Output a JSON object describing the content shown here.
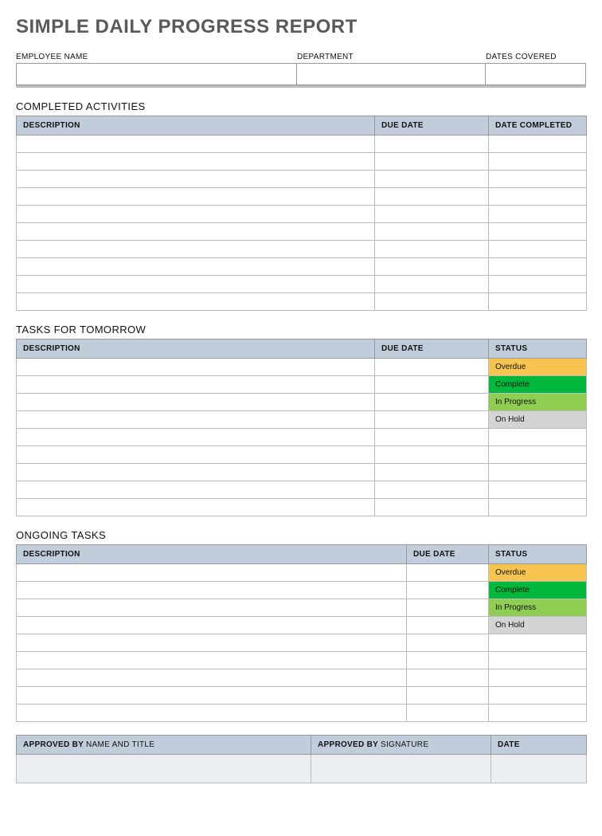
{
  "title": "SIMPLE DAILY PROGRESS REPORT",
  "header": {
    "employee_label": "EMPLOYEE NAME",
    "department_label": "DEPARTMENT",
    "dates_label": "DATES COVERED",
    "employee": "",
    "department": "",
    "dates": ""
  },
  "sections": {
    "completed": {
      "title": "COMPLETED ACTIVITIES",
      "cols": {
        "desc": "DESCRIPTION",
        "due": "DUE DATE",
        "done": "DATE COMPLETED"
      },
      "rows": [
        {
          "description": "",
          "due_date": "",
          "date_completed": ""
        },
        {
          "description": "",
          "due_date": "",
          "date_completed": ""
        },
        {
          "description": "",
          "due_date": "",
          "date_completed": ""
        },
        {
          "description": "",
          "due_date": "",
          "date_completed": ""
        },
        {
          "description": "",
          "due_date": "",
          "date_completed": ""
        },
        {
          "description": "",
          "due_date": "",
          "date_completed": ""
        },
        {
          "description": "",
          "due_date": "",
          "date_completed": ""
        },
        {
          "description": "",
          "due_date": "",
          "date_completed": ""
        },
        {
          "description": "",
          "due_date": "",
          "date_completed": ""
        },
        {
          "description": "",
          "due_date": "",
          "date_completed": ""
        }
      ]
    },
    "tomorrow": {
      "title": "TASKS FOR TOMORROW",
      "cols": {
        "desc": "DESCRIPTION",
        "due": "DUE DATE",
        "status": "STATUS"
      },
      "rows": [
        {
          "description": "",
          "due_date": "",
          "status": "Overdue",
          "status_class": "status-overdue"
        },
        {
          "description": "",
          "due_date": "",
          "status": "Complete",
          "status_class": "status-complete"
        },
        {
          "description": "",
          "due_date": "",
          "status": "In Progress",
          "status_class": "status-inprogress"
        },
        {
          "description": "",
          "due_date": "",
          "status": "On Hold",
          "status_class": "status-onhold"
        },
        {
          "description": "",
          "due_date": "",
          "status": "",
          "status_class": ""
        },
        {
          "description": "",
          "due_date": "",
          "status": "",
          "status_class": ""
        },
        {
          "description": "",
          "due_date": "",
          "status": "",
          "status_class": ""
        },
        {
          "description": "",
          "due_date": "",
          "status": "",
          "status_class": ""
        },
        {
          "description": "",
          "due_date": "",
          "status": "",
          "status_class": ""
        }
      ]
    },
    "ongoing": {
      "title": "ONGOING TASKS",
      "cols": {
        "desc": "DESCRIPTION",
        "due": "DUE DATE",
        "status": "STATUS"
      },
      "rows": [
        {
          "description": "",
          "due_date": "",
          "status": "Overdue",
          "status_class": "status-overdue"
        },
        {
          "description": "",
          "due_date": "",
          "status": "Complete",
          "status_class": "status-complete"
        },
        {
          "description": "",
          "due_date": "",
          "status": "In Progress",
          "status_class": "status-inprogress"
        },
        {
          "description": "",
          "due_date": "",
          "status": "On Hold",
          "status_class": "status-onhold"
        },
        {
          "description": "",
          "due_date": "",
          "status": "",
          "status_class": ""
        },
        {
          "description": "",
          "due_date": "",
          "status": "",
          "status_class": ""
        },
        {
          "description": "",
          "due_date": "",
          "status": "",
          "status_class": ""
        },
        {
          "description": "",
          "due_date": "",
          "status": "",
          "status_class": ""
        },
        {
          "description": "",
          "due_date": "",
          "status": "",
          "status_class": ""
        }
      ]
    }
  },
  "approval": {
    "col1a": "APPROVED BY ",
    "col1b": "NAME AND TITLE",
    "col2a": "APPROVED BY ",
    "col2b": "SIGNATURE",
    "col3": "DATE",
    "name_title": "",
    "signature": "",
    "date": ""
  }
}
